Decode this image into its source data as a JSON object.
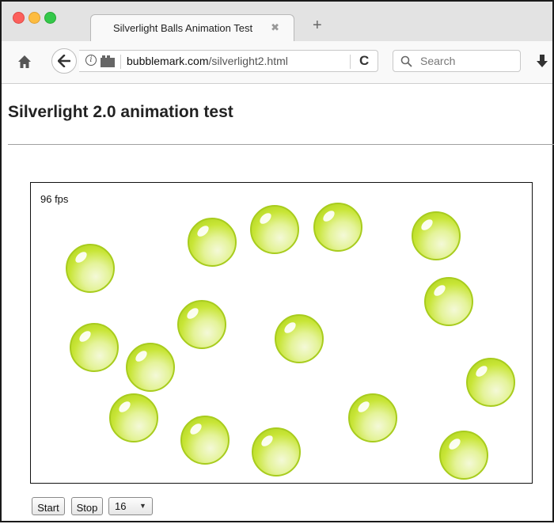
{
  "browser": {
    "tab_title": "Silverlight Balls Animation Test",
    "tab_close": "✖",
    "new_tab": "+",
    "url_domain": "bubblemark.com",
    "url_path": "/silverlight2.html",
    "search_placeholder": "Search"
  },
  "page": {
    "heading": "Silverlight 2.0 animation test",
    "fps": "96 fps",
    "ball_count": 16
  },
  "controls": {
    "start_label": "Start",
    "stop_label": "Stop",
    "count_value": "16",
    "count_arrow": "▼"
  },
  "colors": {
    "ball_fill": "#c8e536",
    "ball_border": "#a8cc1e"
  }
}
